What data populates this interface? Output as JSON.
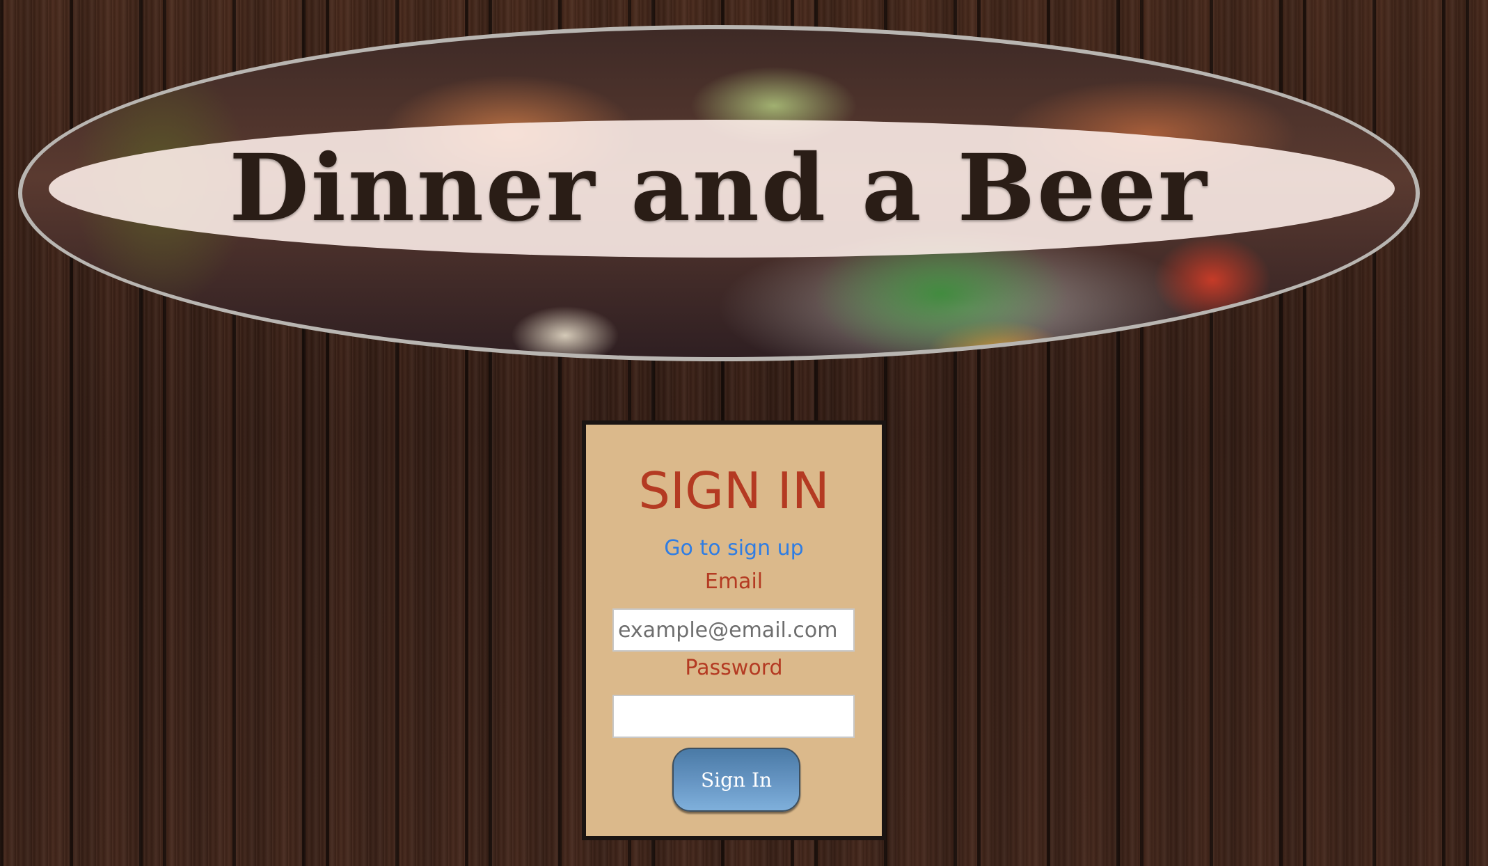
{
  "header": {
    "title": "Dinner and a Beer"
  },
  "signin": {
    "title": "SIGN IN",
    "signup_link": "Go to sign up",
    "email_label": "Email",
    "email_placeholder": "example@email.com",
    "email_value": "",
    "password_label": "Password",
    "password_value": "",
    "submit_label": "Sign In"
  },
  "colors": {
    "card_background": "#dbb98b",
    "heading_red": "#b43a22",
    "link_blue": "#2f7de3",
    "button_blue": "#6796c4"
  }
}
